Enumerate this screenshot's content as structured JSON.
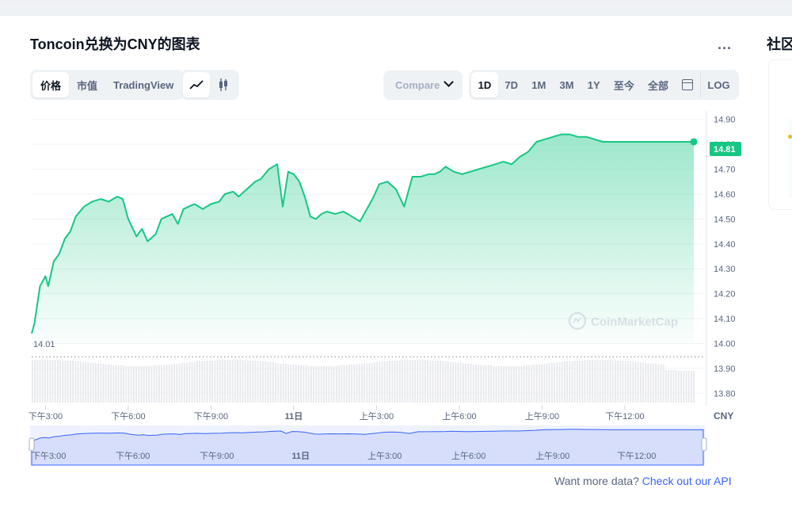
{
  "page": {
    "title": "Toncoin兑换为CNY的图表",
    "more_label": "...",
    "side_title": "社区"
  },
  "toolbar": {
    "metric_tabs": [
      "价格",
      "市值",
      "TradingView"
    ],
    "active_metric": "价格",
    "chart_type_icons": [
      "line-chart-icon",
      "candlestick-icon"
    ],
    "compare_label": "Compare with",
    "ranges": [
      "1D",
      "7D",
      "1M",
      "3M",
      "1Y",
      "至今",
      "全部"
    ],
    "active_range": "1D",
    "calendar_icon": "calendar-icon",
    "log_label": "LOG"
  },
  "footer": {
    "api_text": "Want more data?",
    "api_link": "Check out our API"
  },
  "watermark": "CoinMarketCap",
  "colors": {
    "line": "#16c784",
    "accent": "#3861fb",
    "navigator_fill": "#d6defc"
  },
  "chart_data": {
    "type": "area",
    "title": "Toncoin兑换为CNY的图表",
    "currency_label": "CNY",
    "x_ticks": [
      "下午3:00",
      "下午6:00",
      "下午9:00",
      "11日",
      "上午3:00",
      "上午6:00",
      "上午9:00",
      "下午12:00"
    ],
    "y_ticks": [
      "14.90",
      "14.80",
      "14.70",
      "14.60",
      "14.50",
      "14.40",
      "14.30",
      "14.20",
      "14.10",
      "14.00",
      "13.90",
      "13.80"
    ],
    "ylim": [
      13.75,
      14.95
    ],
    "open_price_label": "14.01",
    "open_price": 14.01,
    "current_price_label": "14.81",
    "current_price": 14.81,
    "x_range_hours": [
      14.5,
      38.5
    ],
    "series": [
      {
        "x": [
          14.5,
          14.6,
          14.8,
          15.0,
          15.1,
          15.3,
          15.5,
          15.7,
          15.9,
          16.1,
          16.4,
          16.7,
          17.0,
          17.3,
          17.6,
          17.8,
          18.0,
          18.3,
          18.5,
          18.7,
          19.0,
          19.2,
          19.4,
          19.6,
          19.8,
          20.0,
          20.2,
          20.4,
          20.7,
          21.0,
          21.3,
          21.5,
          21.8,
          22.0,
          22.3,
          22.6,
          22.8,
          23.1,
          23.4,
          23.6,
          23.8,
          24.0,
          24.2,
          24.4,
          24.6,
          24.8,
          25.0,
          25.2,
          25.5,
          25.8,
          26.1,
          26.4,
          26.7,
          26.9,
          27.1,
          27.4,
          27.7,
          28.0,
          28.3,
          28.6,
          28.9,
          29.1,
          29.3,
          29.5,
          29.8,
          30.1,
          30.4,
          30.7,
          31.0,
          31.3,
          31.6,
          31.9,
          32.2,
          32.5,
          32.8,
          33.1,
          33.4,
          33.7,
          34.0,
          34.3,
          34.6,
          34.9,
          35.2,
          35.5,
          35.8,
          36.1,
          36.4,
          36.7,
          37.0,
          37.3,
          37.6,
          37.9,
          38.2,
          38.5
        ],
        "y": [
          14.04,
          14.08,
          14.23,
          14.27,
          14.23,
          14.33,
          14.36,
          14.42,
          14.45,
          14.51,
          14.55,
          14.57,
          14.58,
          14.57,
          14.59,
          14.58,
          14.5,
          14.43,
          14.46,
          14.41,
          14.44,
          14.5,
          14.51,
          14.52,
          14.48,
          14.54,
          14.55,
          14.56,
          14.54,
          14.56,
          14.57,
          14.6,
          14.61,
          14.59,
          14.62,
          14.65,
          14.66,
          14.7,
          14.72,
          14.55,
          14.69,
          14.68,
          14.65,
          14.59,
          14.51,
          14.5,
          14.52,
          14.53,
          14.52,
          14.53,
          14.51,
          14.49,
          14.55,
          14.59,
          14.64,
          14.65,
          14.62,
          14.55,
          14.67,
          14.67,
          14.68,
          14.68,
          14.69,
          14.71,
          14.69,
          14.68,
          14.69,
          14.7,
          14.71,
          14.72,
          14.73,
          14.72,
          14.75,
          14.77,
          14.81,
          14.82,
          14.83,
          14.84,
          14.84,
          14.83,
          14.83,
          14.82,
          14.81,
          14.81,
          14.81,
          14.81,
          14.81,
          14.81,
          14.81,
          14.81,
          14.81,
          14.81,
          14.81,
          14.81
        ]
      }
    ]
  }
}
